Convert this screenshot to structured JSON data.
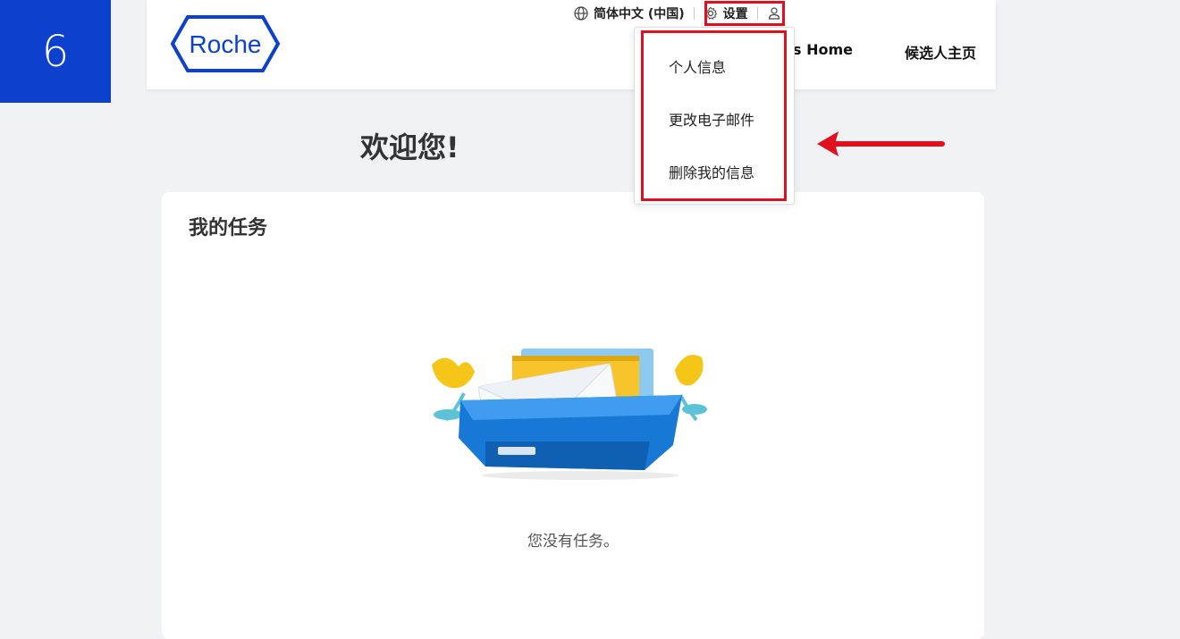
{
  "step_badge": "6",
  "header": {
    "logo_text": "Roche",
    "language": "简体中文 (中国)",
    "settings_label": "设置",
    "nav": {
      "careers_home": "Careers Home",
      "candidate_home": "候选人主页"
    }
  },
  "settings_menu": {
    "items": [
      {
        "label": "个人信息"
      },
      {
        "label": "更改电子邮件"
      },
      {
        "label": "删除我的信息"
      }
    ]
  },
  "welcome": {
    "title": "欢迎您!"
  },
  "tasks": {
    "title": "我的任务",
    "empty_message": "您没有任务。"
  },
  "colors": {
    "brand_blue": "#0b41cd",
    "annotation_red": "#e0101f"
  },
  "icons": {
    "language": "globe-icon",
    "settings": "gear-icon",
    "account": "user-icon"
  }
}
